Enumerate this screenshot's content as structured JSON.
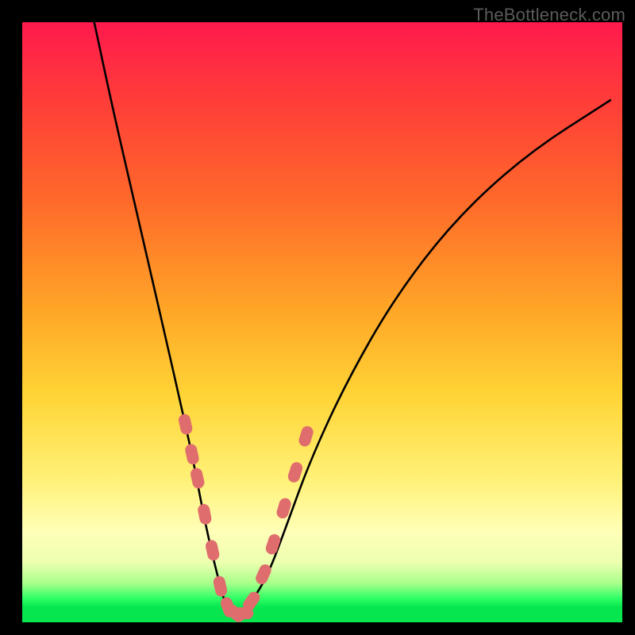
{
  "watermark": "TheBottleneck.com",
  "chart_data": {
    "type": "line",
    "title": "",
    "xlabel": "",
    "ylabel": "",
    "xlim": [
      0,
      100
    ],
    "ylim": [
      0,
      100
    ],
    "grid": false,
    "background_gradient": {
      "top": "#ff1a4d",
      "upper_mid": "#ffa627",
      "mid": "#fff176",
      "lower": "#a8ff8a",
      "bottom": "#06e64f"
    },
    "series": [
      {
        "name": "bottleneck-curve",
        "color": "#000000",
        "x": [
          12,
          15,
          18,
          21,
          24,
          26.5,
          28.5,
          30,
          31.5,
          33,
          34,
          35,
          36,
          38,
          41,
          44,
          48,
          54,
          62,
          72,
          84,
          98
        ],
        "y": [
          100,
          86,
          73,
          60,
          47,
          36,
          27,
          19,
          12,
          6,
          2.5,
          1.2,
          1.2,
          3,
          8,
          16,
          27,
          40,
          54,
          67,
          78,
          87
        ]
      },
      {
        "name": "highlight-dots",
        "color": "#e06d6d",
        "marker": "pill",
        "x": [
          27.2,
          28.3,
          29.2,
          30.4,
          31.7,
          33.0,
          34.3,
          35.5,
          36.8,
          38.2,
          40.2,
          41.8,
          43.6,
          45.5,
          47.3
        ],
        "y": [
          33,
          28,
          24,
          18,
          12,
          6,
          2.5,
          1.5,
          1.5,
          3.5,
          8,
          13,
          19,
          25,
          31
        ]
      }
    ],
    "minimum_x": 35.5,
    "minimum_y": 1.2
  }
}
